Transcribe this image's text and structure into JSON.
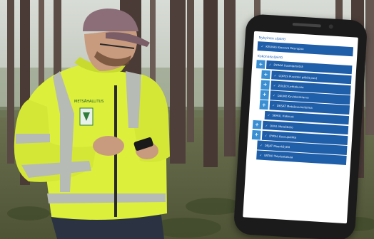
{
  "phone_screen": {
    "section_1_title": "Nykyinen sijainti",
    "current_location": {
      "glyph": "✓",
      "label": "KEUKAS Kasvava Kasvupuu"
    },
    "section_2_title": "Kokonaissijainti",
    "rows": [
      {
        "level": 0,
        "button": "+",
        "glyph": "✓",
        "label": "DYKAA Uusintametsä"
      },
      {
        "level": 1,
        "button": "+",
        "glyph": "✓",
        "label": "CDPUS Puustoin pitkät puut"
      },
      {
        "level": 1,
        "button": "+",
        "glyph": "✓",
        "label": "ZOLEO Lehtokuvio"
      },
      {
        "level": 1,
        "button": "+",
        "glyph": "✓",
        "label": "DAUKK Kuviokeskiarvo"
      },
      {
        "level": 1,
        "button": "+",
        "glyph": "✓",
        "label": "DKSAT Metsäsuunnitelma"
      },
      {
        "level": 2,
        "button": "",
        "glyph": "✓",
        "label": "SKHUL Hakkuut"
      },
      {
        "level": 0,
        "button": "+",
        "glyph": "✓",
        "label": "DUVL Metsätieto"
      },
      {
        "level": 0,
        "button": "+",
        "glyph": "✓",
        "label": "DYKAL Kasvupaikka"
      },
      {
        "level": 1,
        "button": "",
        "glyph": "✓",
        "label": "DEJAT Maankäyttö"
      },
      {
        "level": 1,
        "button": "",
        "glyph": "✓",
        "label": "SRTKO Tuloksetaikaa"
      }
    ]
  },
  "vest_logo_text": "METSÄHALLITUS",
  "colors": {
    "screen_bar": "#1f5ea8",
    "screen_button": "#3a8fd3",
    "vest": "#dcf03a",
    "reflective_strip": "#b8bcb8"
  }
}
